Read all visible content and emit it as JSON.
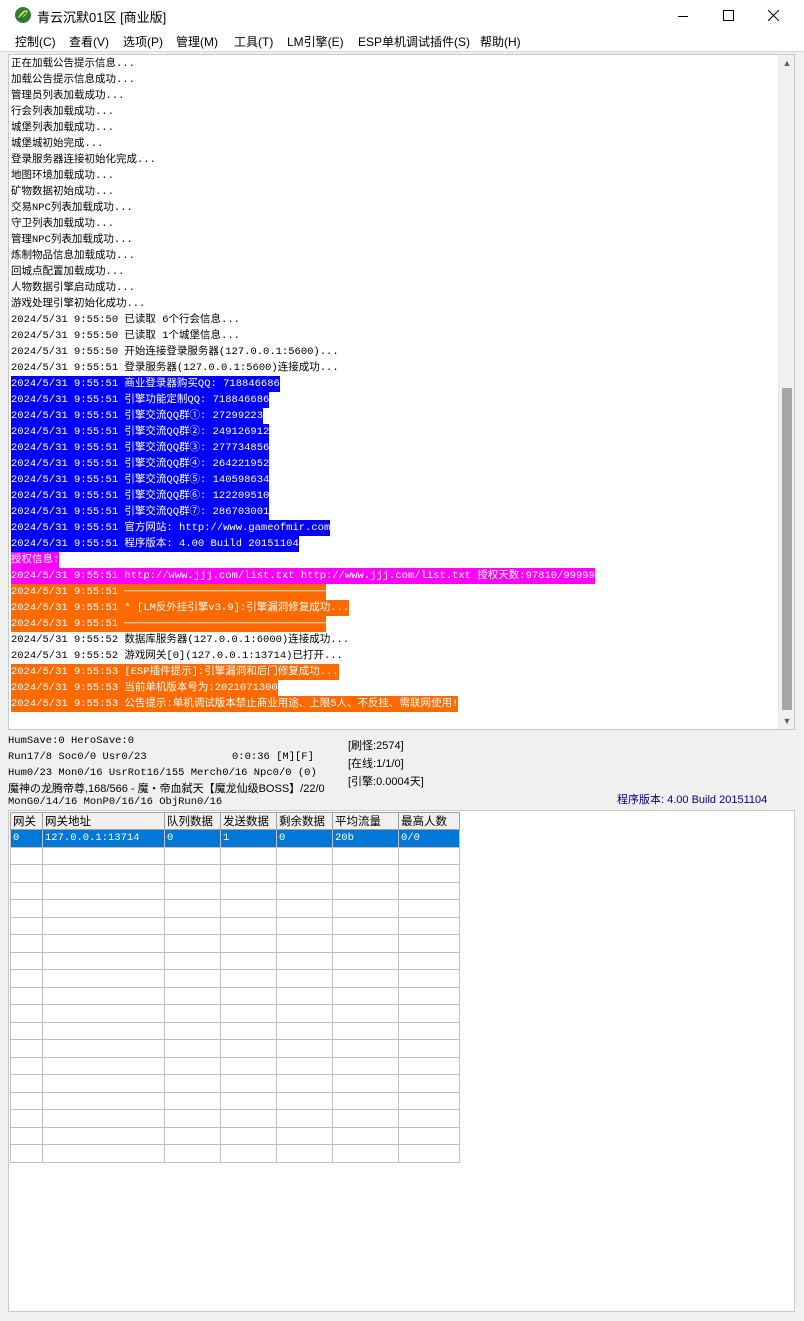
{
  "window": {
    "title": "青云沉默01区 [商业版]",
    "colors": {
      "accent_blue": "#0000ff",
      "magenta": "#ff00ff",
      "orange": "#ff6a00",
      "selection": "#0078d7"
    }
  },
  "menu": {
    "items": [
      {
        "label": "控制(C)"
      },
      {
        "label": "查看(V)"
      },
      {
        "label": "选项(P)"
      },
      {
        "label": "管理(M)"
      },
      {
        "label": "工具(T)"
      },
      {
        "label": "LM引擎(E)"
      },
      {
        "label": "ESP单机调试插件(S)"
      },
      {
        "label": "帮助(H)"
      }
    ]
  },
  "log": {
    "lines": [
      {
        "text": "正在加载公告提示信息...",
        "style": "none"
      },
      {
        "text": "加载公告提示信息成功...",
        "style": "none"
      },
      {
        "text": "管理员列表加载成功...",
        "style": "none"
      },
      {
        "text": "行会列表加载成功...",
        "style": "none"
      },
      {
        "text": "城堡列表加载成功...",
        "style": "none"
      },
      {
        "text": "城堡城初始完成...",
        "style": "none"
      },
      {
        "text": "登录服务器连接初始化完成...",
        "style": "none"
      },
      {
        "text": "地图环境加载成功...",
        "style": "none"
      },
      {
        "text": "矿物数据初始成功...",
        "style": "none"
      },
      {
        "text": "交易NPC列表加载成功...",
        "style": "none"
      },
      {
        "text": "守卫列表加载成功...",
        "style": "none"
      },
      {
        "text": "管理NPC列表加载成功...",
        "style": "none"
      },
      {
        "text": "炼制物品信息加载成功...",
        "style": "none"
      },
      {
        "text": "回城点配置加载成功...",
        "style": "none"
      },
      {
        "text": "人物数据引擎启动成功...",
        "style": "none"
      },
      {
        "text": "游戏处理引擎初始化成功...",
        "style": "none"
      },
      {
        "text": "2024/5/31 9:55:50 已读取 6个行会信息...",
        "style": "none"
      },
      {
        "text": "2024/5/31 9:55:50 已读取 1个城堡信息...",
        "style": "none"
      },
      {
        "text": "2024/5/31 9:55:50 开始连接登录服务器(127.0.0.1:5600)...",
        "style": "none"
      },
      {
        "text": "2024/5/31 9:55:51 登录服务器(127.0.0.1:5600)连接成功...",
        "style": "none"
      },
      {
        "text": "2024/5/31 9:55:51 商业登录器购买QQ: 718846686",
        "style": "blue"
      },
      {
        "text": "2024/5/31 9:55:51 引擎功能定制QQ: 718846686",
        "style": "blue"
      },
      {
        "text": "2024/5/31 9:55:51 引擎交流QQ群①: 27299223",
        "style": "blue"
      },
      {
        "text": "2024/5/31 9:55:51 引擎交流QQ群②: 249126912",
        "style": "blue"
      },
      {
        "text": "2024/5/31 9:55:51 引擎交流QQ群③: 277734856",
        "style": "blue"
      },
      {
        "text": "2024/5/31 9:55:51 引擎交流QQ群④: 264221952",
        "style": "blue"
      },
      {
        "text": "2024/5/31 9:55:51 引擎交流QQ群⑤: 140598634",
        "style": "blue"
      },
      {
        "text": "2024/5/31 9:55:51 引擎交流QQ群⑥: 122209510",
        "style": "blue"
      },
      {
        "text": "2024/5/31 9:55:51 引擎交流QQ群⑦: 286703001",
        "style": "blue"
      },
      {
        "text": "2024/5/31 9:55:51 官方网站: http://www.gameofmir.com",
        "style": "blue"
      },
      {
        "text": "2024/5/31 9:55:51 程序版本: 4.00 Build 20151104",
        "style": "blue"
      },
      {
        "text": "授权信息:",
        "style": "magenta"
      },
      {
        "text": "2024/5/31 9:55:51 http://www.jjj.com/list.txt http://www.jjj.com/list.txt 授权天数:97810/99999",
        "style": "magenta"
      },
      {
        "text": "2024/5/31 9:55:51 ────────────────────────────────",
        "style": "orange"
      },
      {
        "text": "2024/5/31 9:55:51 * [LM反外挂引擎v3.9]:引擎漏洞修复成功...",
        "style": "orange"
      },
      {
        "text": "2024/5/31 9:55:51 ────────────────────────────────",
        "style": "orange"
      },
      {
        "text": "2024/5/31 9:55:52 数据库服务器(127.0.0.1:6000)连接成功...",
        "style": "none"
      },
      {
        "text": "2024/5/31 9:55:52 游戏网关[0](127.0.0.1:13714)已打开...",
        "style": "none"
      },
      {
        "text": "2024/5/31 9:55:53 [ESP插件提示]:引擎漏洞和后门修复成功...",
        "style": "orange"
      },
      {
        "text": "2024/5/31 9:55:53 当前单机版本号为:2021071300",
        "style": "orange"
      },
      {
        "text": "2024/5/31 9:55:53 公告提示:单机调试版本禁止商业用途、上限5人、不反挂、需联网使用!",
        "style": "orange"
      }
    ]
  },
  "status": {
    "line1": "HumSave:0 HeroSave:0",
    "line2": "Run17/8 Soc0/0 Usr0/23",
    "line2_time": "0:0:36 [M][F]",
    "line3": "Hum0/23 Mon0/16 UsrRot16/155 Merch0/16 Npc0/0 (0)",
    "line4": "魔神の龙腾帝尊,168/566 - 魔・帝血弑天【魔龙仙级BOSS】/22/0",
    "line5": "MonG0/14/16 MonP0/16/16 ObjRun0/16",
    "refresh": "[刷怪:2574]",
    "online": "[在线:1/1/0]",
    "engine": "[引擎:0.0004天]",
    "version": "程序版本: 4.00 Build 20151104"
  },
  "grid": {
    "headers": [
      "网关",
      "网关地址",
      "队列数据",
      "发送数据",
      "剩余数据",
      "平均流量",
      "最高人数"
    ],
    "rows": [
      [
        "0",
        "127.0.0.1:13714",
        "0",
        "1",
        "0",
        "20b",
        "0/0"
      ]
    ],
    "empty_rows": 18
  }
}
